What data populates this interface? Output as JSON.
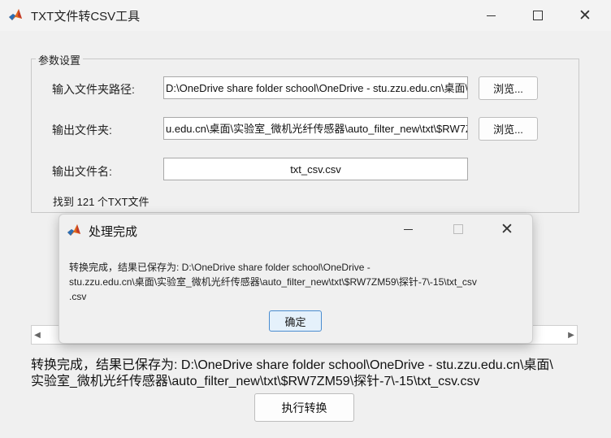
{
  "window": {
    "title": "TXT文件转CSV工具"
  },
  "params": {
    "group_label": "参数设置",
    "input_folder_label": "输入文件夹路径:",
    "input_folder_value": "D:\\OneDrive share folder school\\OneDrive - stu.zzu.edu.cn\\桌面\\",
    "output_folder_label": "输出文件夹:",
    "output_folder_value": "u.edu.cn\\桌面\\实验室_微机光纤传感器\\auto_filter_new\\txt\\$RW7Z",
    "output_file_label": "输出文件名:",
    "output_file_value": "txt_csv.csv",
    "browse_label": "浏览...",
    "found_text": "找到 121 个TXT文件"
  },
  "status": {
    "line1": "转换完成，结果已保存为: D:\\OneDrive share folder school\\OneDrive - stu.zzu.edu.cn\\桌面\\",
    "line2": "实验室_微机光纤传感器\\auto_filter_new\\txt\\$RW7ZM59\\探针-7\\-15\\txt_csv.csv"
  },
  "run_button": "执行转换",
  "dialog": {
    "title": "处理完成",
    "msg_line1": "转换完成，结果已保存为: D:\\OneDrive share folder school\\OneDrive -",
    "msg_line2": "stu.zzu.edu.cn\\桌面\\实验室_微机光纤传感器\\auto_filter_new\\txt\\$RW7ZM59\\探针-7\\-15\\txt_csv",
    "msg_line3": ".csv",
    "ok_label": "确定"
  }
}
